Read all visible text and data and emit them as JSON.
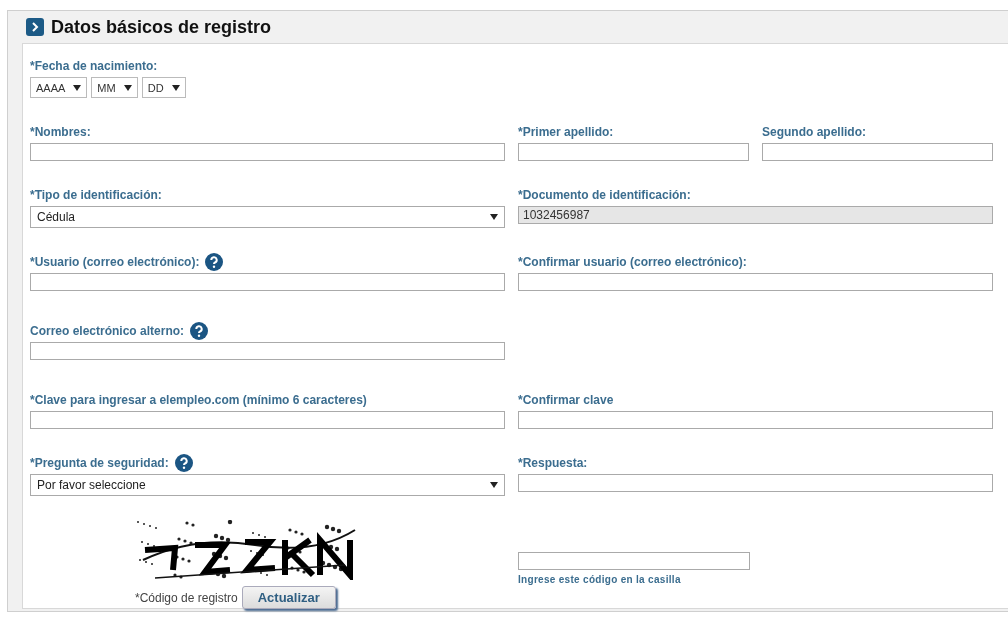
{
  "section": {
    "title": "Datos básicos de registro"
  },
  "rows": [
    {
      "left": {
        "kind": "date",
        "label": "*Fecha de nacimiento:",
        "help": false,
        "selects": [
          {
            "value": "AAAA"
          },
          {
            "value": "MM"
          },
          {
            "value": "DD"
          }
        ]
      }
    },
    {
      "left": {
        "kind": "text",
        "label": "*Nombres:",
        "help": false,
        "disabled": false
      },
      "right": [
        {
          "kind": "text",
          "label": "*Primer apellido:",
          "help": false,
          "disabled": false
        },
        {
          "kind": "text",
          "label": "Segundo apellido:",
          "help": false,
          "disabled": false
        }
      ]
    },
    {
      "left": {
        "kind": "select",
        "label": "*Tipo de identificación:",
        "help": false,
        "value": "Cédula"
      },
      "right": [
        {
          "kind": "text",
          "label": "*Documento de identificación:",
          "help": false,
          "disabled": true,
          "value": "1032456987"
        }
      ]
    },
    {
      "left": {
        "kind": "text",
        "label": "*Usuario (correo electrónico):",
        "help": true,
        "disabled": false
      },
      "right": [
        {
          "kind": "text",
          "label": "*Confirmar usuario (correo electrónico):",
          "help": false,
          "disabled": false
        }
      ]
    },
    {
      "left": {
        "kind": "text",
        "label": "Correo electrónico alterno:",
        "help": true,
        "disabled": false
      }
    },
    {
      "left": {
        "kind": "text",
        "label": "*Clave para ingresar a elempleo.com (mínimo 6 caracteres)",
        "help": false,
        "disabled": false
      },
      "right": [
        {
          "kind": "text",
          "label": "*Confirmar clave",
          "help": false,
          "disabled": false
        }
      ]
    },
    {
      "left": {
        "kind": "select",
        "label": "*Pregunta de seguridad:",
        "help": true,
        "value": "Por favor seleccione"
      },
      "right": [
        {
          "kind": "text",
          "label": "*Respuesta:",
          "help": false,
          "disabled": false
        }
      ]
    }
  ],
  "captcha": {
    "label": "*Código de registro",
    "button": "Actualizar",
    "hint": "Ingrese este código en la casilla"
  }
}
